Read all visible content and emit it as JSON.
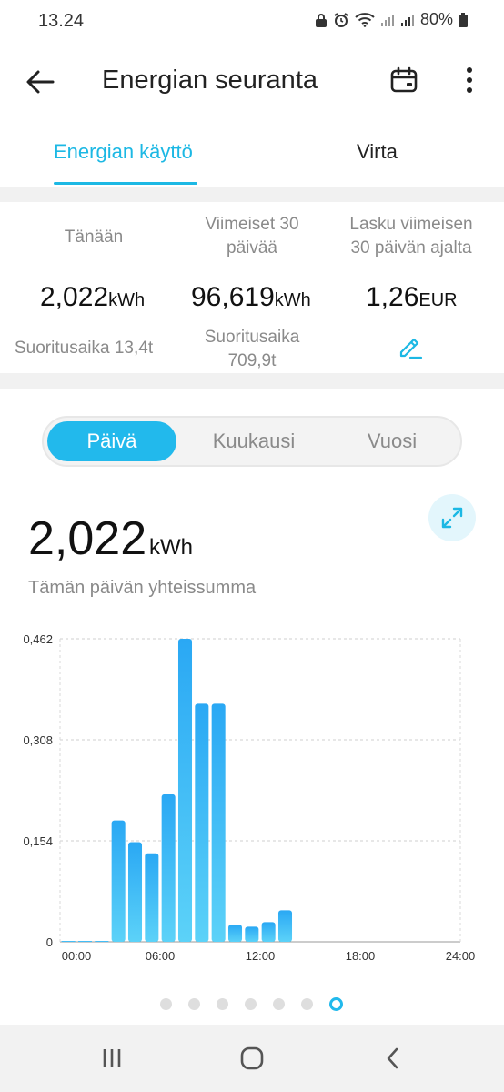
{
  "status_bar": {
    "time": "13.24",
    "battery": "80%"
  },
  "app_bar": {
    "title": "Energian seuranta"
  },
  "tabs": [
    {
      "label": "Energian käyttö",
      "active": true
    },
    {
      "label": "Virta",
      "active": false
    }
  ],
  "summary": {
    "today": {
      "label": "Tänään",
      "value": "2,022",
      "unit": "kWh",
      "sub": "Suoritusaika 13,4t"
    },
    "last30": {
      "label_line1": "Viimeiset 30",
      "label_line2": "päivää",
      "value": "96,619",
      "unit": "kWh",
      "sub_line1": "Suoritusaika",
      "sub_line2": "709,9t"
    },
    "bill": {
      "label_line1": "Lasku viimeisen",
      "label_line2": "30 päivän ajalta",
      "value": "1,26",
      "unit": "EUR"
    }
  },
  "period_selector": {
    "options": [
      "Päivä",
      "Kuukausi",
      "Vuosi"
    ],
    "selected": "Päivä"
  },
  "total": {
    "value": "2,022",
    "unit": "kWh",
    "caption": "Tämän päivän yhteissumma"
  },
  "colors": {
    "accent": "#1cb8e4",
    "bar_top": "#2aa8f4",
    "bar_bottom": "#5cd2f8"
  },
  "chart_data": {
    "type": "bar",
    "title": "",
    "xlabel": "",
    "ylabel": "",
    "ylim": [
      0,
      0.462
    ],
    "yticks": [
      "0",
      "0,154",
      "0,308",
      "0,462"
    ],
    "ytick_values": [
      0,
      0.154,
      0.308,
      0.462
    ],
    "xticks": [
      "00:00",
      "06:00",
      "12:00",
      "18:00",
      "24:00"
    ],
    "xtick_hours": [
      0,
      6,
      12,
      18,
      24
    ],
    "categories": [
      "00",
      "01",
      "02",
      "03",
      "04",
      "05",
      "06",
      "07",
      "08",
      "09",
      "10",
      "11",
      "12",
      "13",
      "14",
      "15",
      "16",
      "17",
      "18",
      "19",
      "20",
      "21",
      "22",
      "23"
    ],
    "values": [
      0.0,
      0.0,
      0.0,
      0.185,
      0.152,
      0.135,
      0.225,
      0.462,
      0.363,
      0.363,
      0.026,
      0.023,
      0.03,
      0.048,
      0,
      0,
      0,
      0,
      0,
      0,
      0,
      0,
      0,
      0
    ],
    "grid": true
  },
  "pager": {
    "count": 7,
    "active_index": 6
  }
}
